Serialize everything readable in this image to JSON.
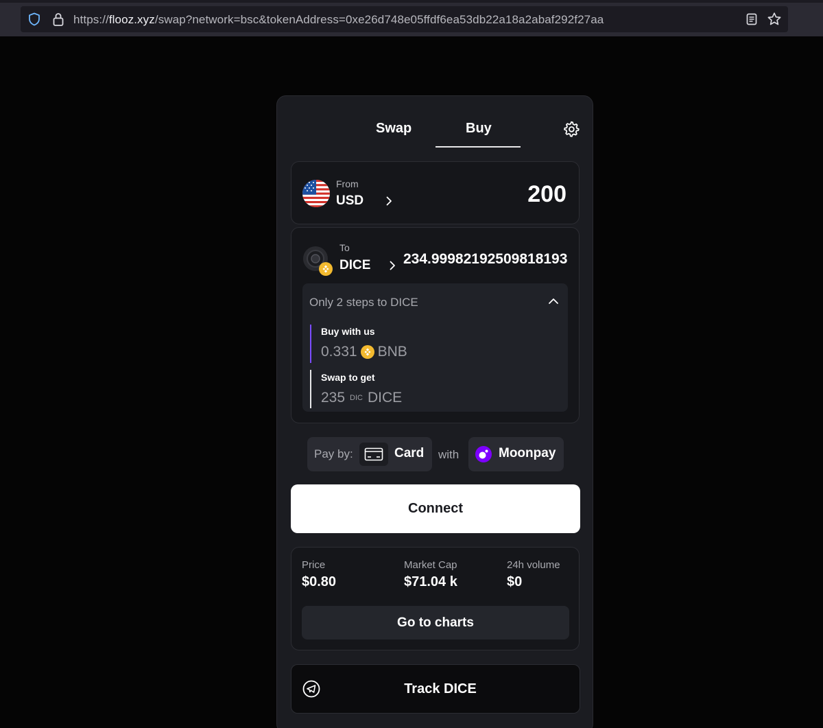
{
  "browser": {
    "url_prefix": "https://",
    "url_host": "flooz.xyz",
    "url_path": "/swap?network=bsc&tokenAddress=0xe26d748e05ffdf6ea53db22a18a2abaf292f27aa"
  },
  "tabs": {
    "swap": "Swap",
    "buy": "Buy",
    "active": "buy"
  },
  "from": {
    "label": "From",
    "currency": "USD",
    "amount": "200",
    "icon": "us-flag-icon"
  },
  "to": {
    "label": "To",
    "token": "DICE",
    "amount": "234.999821925098181937",
    "icon": "dice-token-icon"
  },
  "steps": {
    "title": "Only 2 steps to DICE",
    "step1": {
      "title": "Buy with us",
      "value": "0.331",
      "unit": "BNB",
      "accent": "#7b4dff"
    },
    "step2": {
      "title": "Swap to get",
      "value": "235",
      "tag": "DIC",
      "unit": "DICE",
      "accent": "#e8e8ea"
    }
  },
  "payment": {
    "pay_label": "Pay by:",
    "method": "Card",
    "with_label": "with",
    "provider": "Moonpay"
  },
  "connect_label": "Connect",
  "stats": {
    "price_label": "Price",
    "price_value": "$0.80",
    "mcap_label": "Market Cap",
    "mcap_value": "$71.04 k",
    "volume_label": "24h volume",
    "volume_value": "$0",
    "charts_label": "Go to charts"
  },
  "track_label": "Track DICE",
  "colors": {
    "background": "#050505",
    "panel": "#1b1c21",
    "accent_purple": "#7b4dff",
    "bnb_yellow": "#f3ba2f"
  }
}
